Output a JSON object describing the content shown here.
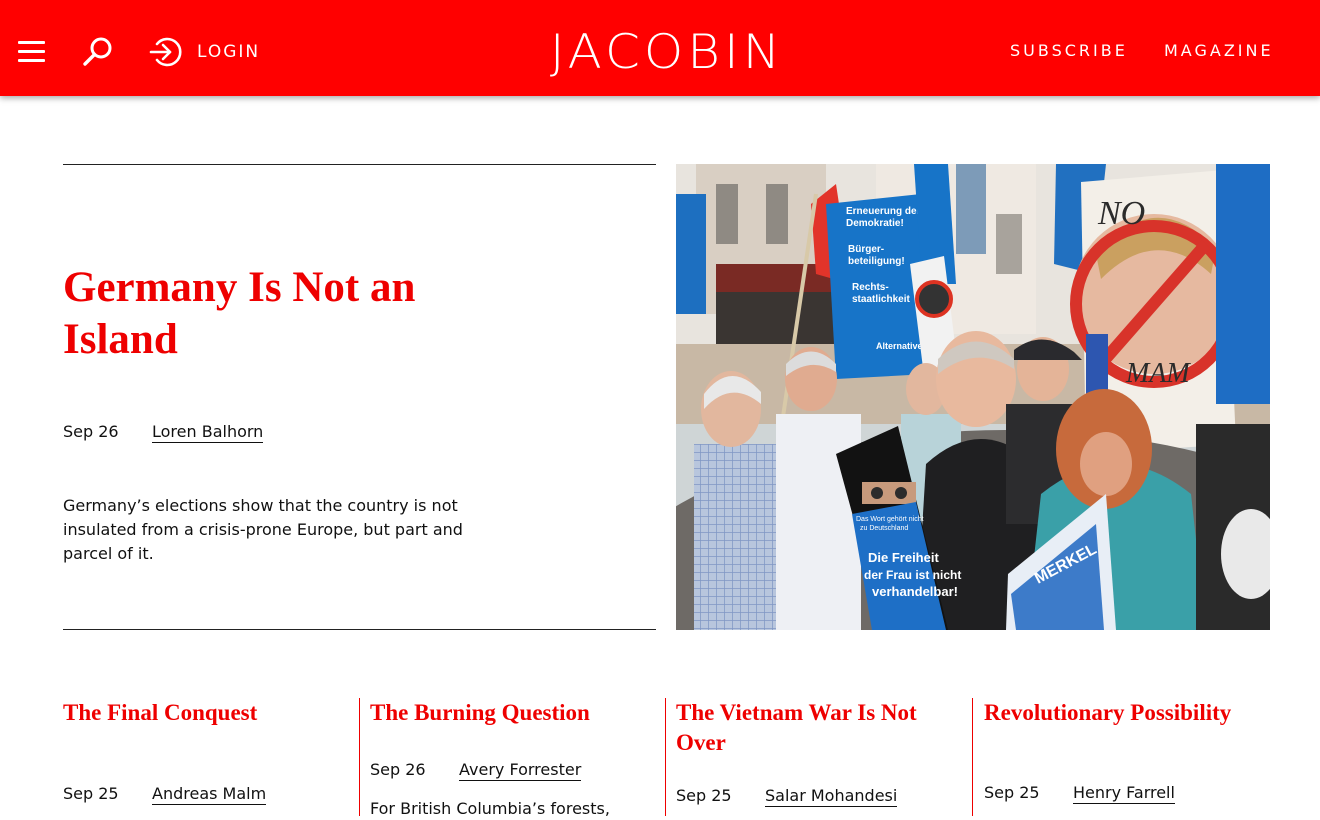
{
  "header": {
    "login_label": "LOGIN",
    "logo": "JACOBIN",
    "nav": {
      "subscribe": "SUBSCRIBE",
      "magazine": "MAGAZINE"
    },
    "icons": [
      "menu-icon",
      "search-icon",
      "login-icon"
    ],
    "background_color": "#ff0000"
  },
  "hero": {
    "title": "Germany Is Not an Island",
    "date": "Sep 26",
    "author": "Loren Balhorn",
    "dek": "Germany’s elections show that the country is not insulated from a crisis-prone Europe, but part and parcel of it.",
    "image": {
      "signs": {
        "sign1_lines": [
          "Erneuerung der",
          "Demokratie!",
          "Bürger-",
          "beteiligung!",
          "Rechts-",
          "staatlichkeit"
        ],
        "sign1_brand": "Alternative",
        "sign2_lines": [
          "Die Freiheit",
          "der Frau ist nicht",
          "verhandelbar!"
        ],
        "sign2_small": [
          "Das Wort gehört nicht",
          "zu Deutschland"
        ],
        "poster_top": "NO",
        "poster_bottom": "MAM",
        "sign3": "MERKEL"
      }
    }
  },
  "cards": [
    {
      "title": "The Final Conquest",
      "date": "Sep 25",
      "author": "Andreas Malm"
    },
    {
      "title": "The Burning Question",
      "date": "Sep 26",
      "author": "Avery Forrester",
      "dek": "For British Columbia’s forests,"
    },
    {
      "title": "The Vietnam War Is Not Over",
      "date": "Sep 25",
      "author": "Salar Mohandesi"
    },
    {
      "title": "Revolutionary Possibility",
      "date": "Sep 25",
      "author": "Henry Farrell"
    }
  ],
  "colors": {
    "accent": "#ee0000",
    "text": "#111111"
  }
}
